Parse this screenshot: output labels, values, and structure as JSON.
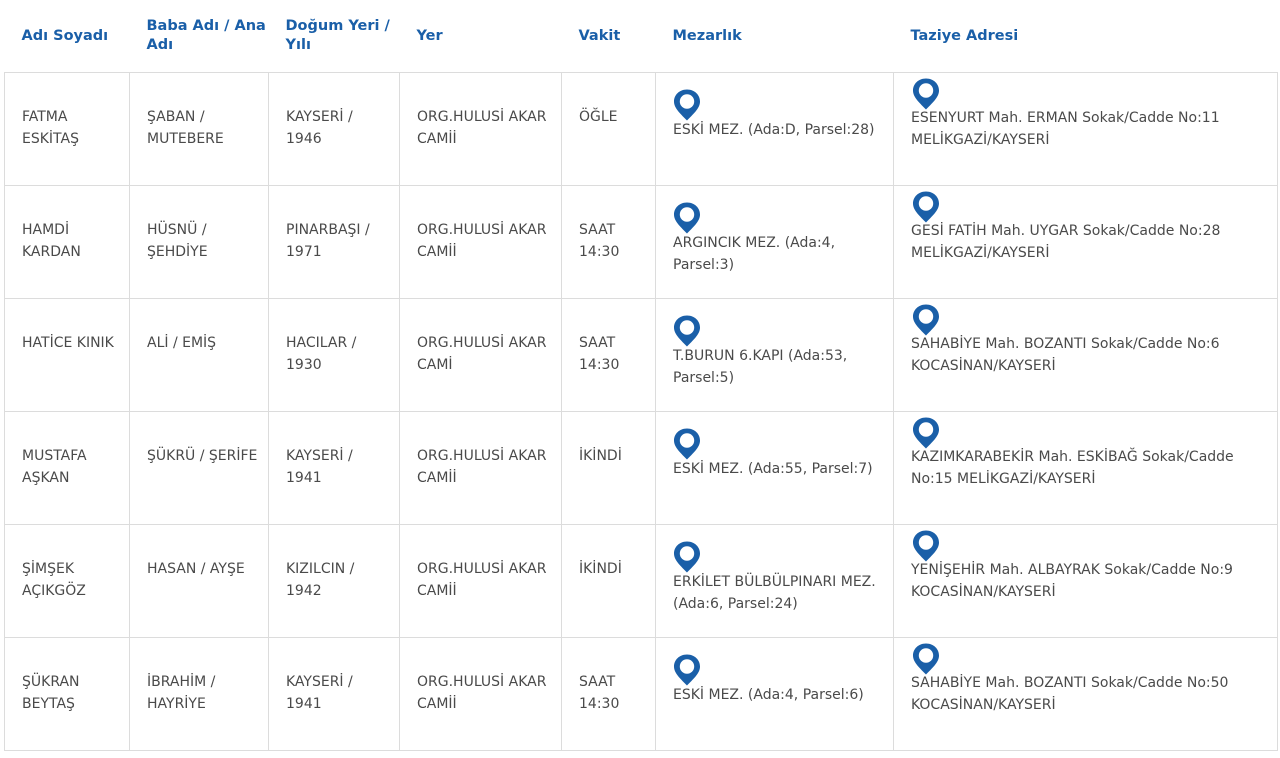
{
  "colors": {
    "header_text": "#1a5fa8",
    "pin": "#1a5fa8",
    "border": "#dcdcdc",
    "cell_text": "#4a4a4a"
  },
  "icons": {
    "location": "map-pin-icon"
  },
  "table": {
    "headers": {
      "name": "Adı Soyadı",
      "parents": "Baba Adı / Ana Adı",
      "birth": "Doğum Yeri / Yılı",
      "place": "Yer",
      "time": "Vakit",
      "cemetery": "Mezarlık",
      "address": "Taziye Adresi"
    },
    "rows": [
      {
        "name": "FATMA ESKİTAŞ",
        "parents": "ŞABAN / MUTEBERE",
        "birth": "KAYSERİ / 1946",
        "place": "ORG.HULUSİ AKAR CAMİİ",
        "time": "ÖĞLE",
        "cemetery": "ESKİ MEZ. (Ada:D, Parsel:28)",
        "address": "ESENYURT Mah. ERMAN Sokak/Cadde No:11 MELİKGAZİ/KAYSERİ"
      },
      {
        "name": "HAMDİ KARDAN",
        "parents": "HÜSNÜ / ŞEHDİYE",
        "birth": "PINARBAŞI / 1971",
        "place": "ORG.HULUSİ AKAR CAMİİ",
        "time": "SAAT 14:30",
        "cemetery": "ARGINCIK MEZ. (Ada:4, Parsel:3)",
        "address": "GESİ FATİH Mah. UYGAR Sokak/Cadde No:28 MELİKGAZİ/KAYSERİ"
      },
      {
        "name": "HATİCE KINIK",
        "parents": "ALİ / EMİŞ",
        "birth": "HACILAR / 1930",
        "place": "ORG.HULUSİ AKAR CAMİ",
        "time": "SAAT 14:30",
        "cemetery": "T.BURUN 6.KAPI (Ada:53, Parsel:5)",
        "address": "SAHABİYE Mah. BOZANTI Sokak/Cadde No:6 KOCASİNAN/KAYSERİ"
      },
      {
        "name": "MUSTAFA AŞKAN",
        "parents": "ŞÜKRÜ / ŞERİFE",
        "birth": "KAYSERİ / 1941",
        "place": "ORG.HULUSİ AKAR CAMİİ",
        "time": "İKİNDİ",
        "cemetery": "ESKİ MEZ. (Ada:55, Parsel:7)",
        "address": "KAZIMKARABEKİR Mah. ESKİBAĞ Sokak/Cadde No:15 MELİKGAZİ/KAYSERİ"
      },
      {
        "name": "ŞİMŞEK AÇIKGÖZ",
        "parents": "HASAN / AYŞE",
        "birth": "KIZILCIN / 1942",
        "place": "ORG.HULUSİ AKAR CAMİİ",
        "time": "İKİNDİ",
        "cemetery": "ERKİLET BÜLBÜLPINARI MEZ. (Ada:6, Parsel:24)",
        "address": "YENİŞEHİR Mah. ALBAYRAK Sokak/Cadde No:9 KOCASİNAN/KAYSERİ"
      },
      {
        "name": "ŞÜKRAN BEYTAŞ",
        "parents": "İBRAHİM / HAYRİYE",
        "birth": "KAYSERİ / 1941",
        "place": "ORG.HULUSİ AKAR CAMİİ",
        "time": "SAAT 14:30",
        "cemetery": "ESKİ MEZ. (Ada:4, Parsel:6)",
        "address": "SAHABİYE Mah. BOZANTI Sokak/Cadde No:50 KOCASİNAN/KAYSERİ"
      }
    ]
  }
}
